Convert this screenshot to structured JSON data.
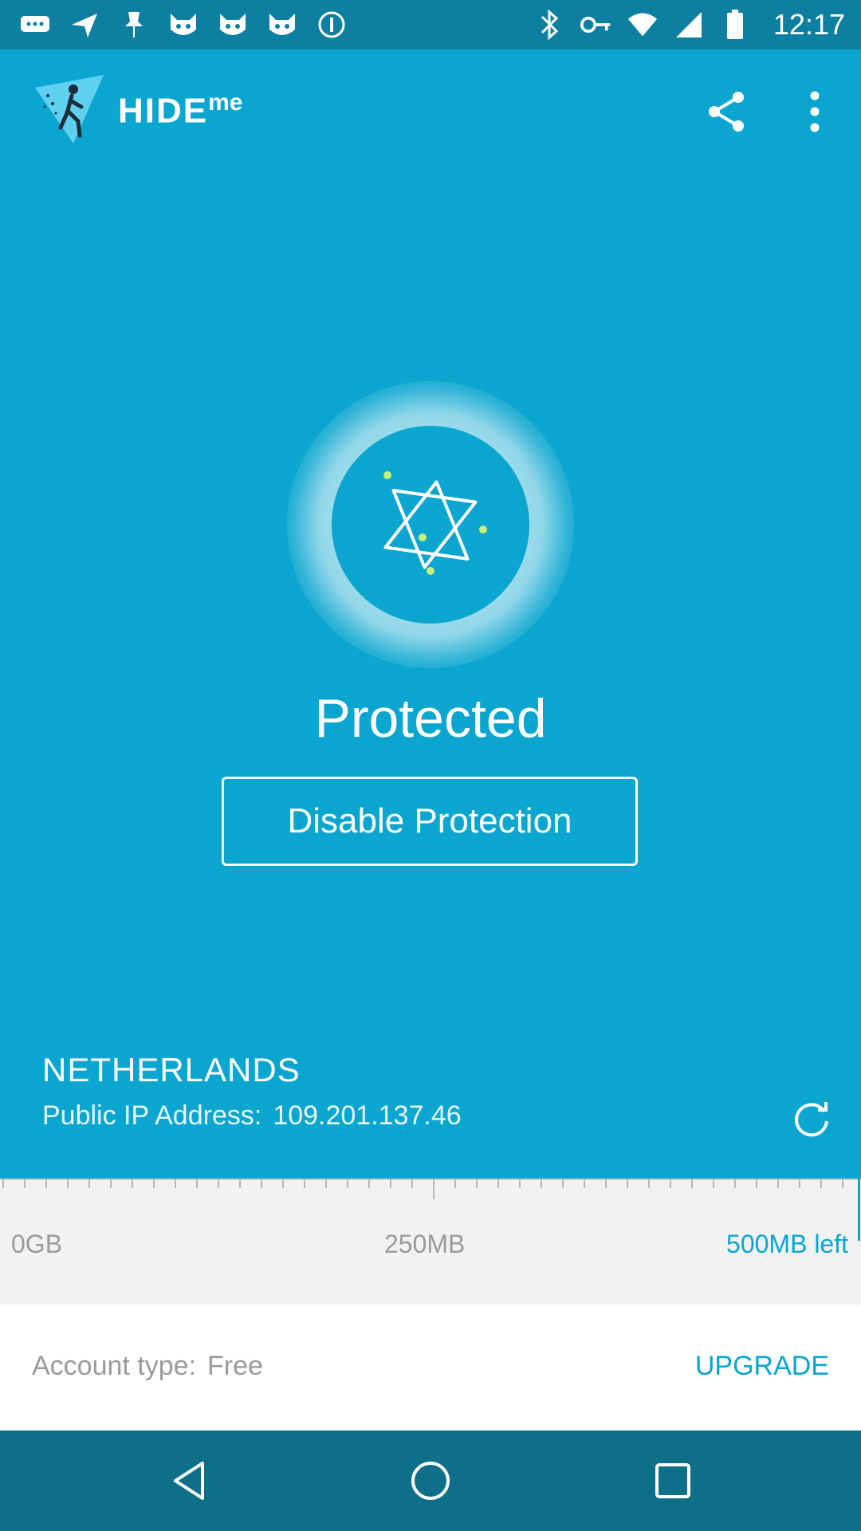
{
  "status_bar": {
    "time": "12:17",
    "notification_icons": [
      "messages-icon",
      "send-icon",
      "pin-icon",
      "cat-icon",
      "cat-icon",
      "cat-icon",
      "info-icon"
    ],
    "system_icons": [
      "bluetooth-icon",
      "vpn-key-icon",
      "wifi-icon",
      "signal-icon",
      "battery-icon"
    ]
  },
  "app_bar": {
    "logo_text": "HIDE",
    "logo_suffix": "me",
    "actions": [
      "share-icon",
      "more-vert-icon"
    ]
  },
  "connection": {
    "status": "Protected",
    "button_label": "Disable Protection"
  },
  "location": {
    "country": "NETHERLANDS",
    "ip_label": "Public IP Address:",
    "ip_value": "109.201.137.46"
  },
  "data_usage": {
    "min_label": "0GB",
    "mid_label": "250MB",
    "remaining_label": "500MB left",
    "used_fraction": 0.0
  },
  "account": {
    "type_label": "Account type:",
    "type_value": "Free",
    "upgrade_label": "UPGRADE"
  },
  "nav_bar": {
    "buttons": [
      "back-icon",
      "home-icon",
      "recents-icon"
    ]
  },
  "colors": {
    "primary": "#0aa6cf",
    "status_bar": "#0d7fa0",
    "nav_bar": "#0d6f88",
    "usage_bg": "#f2f2f2",
    "accent_dots": "#c8f07a"
  }
}
